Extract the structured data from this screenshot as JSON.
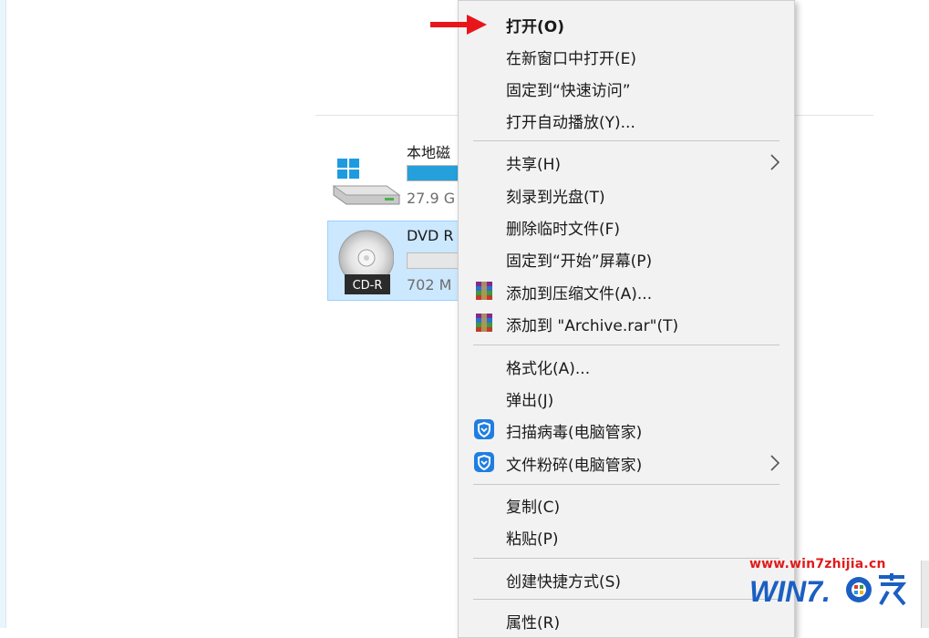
{
  "drives": [
    {
      "name": "本地磁",
      "size": "27.9 G",
      "usage_fraction": 0.85,
      "icon": "windows-drive-icon",
      "bar_color": "#26a0da"
    },
    {
      "name": "DVD R",
      "size": "702 M",
      "usage_fraction": 0.0,
      "icon": "cd-r-disc-icon",
      "badge": "CD-R",
      "selected": true
    }
  ],
  "context_menu": {
    "items": [
      {
        "label": "打开(O)",
        "bold": true
      },
      {
        "label": "在新窗口中打开(E)"
      },
      {
        "label": "固定到“快速访问”"
      },
      {
        "label": "打开自动播放(Y)..."
      },
      {
        "label": "共享(H)",
        "submenu": true
      },
      {
        "label": "刻录到光盘(T)"
      },
      {
        "label": "删除临时文件(F)"
      },
      {
        "label": "固定到“开始”屏幕(P)"
      },
      {
        "label": "添加到压缩文件(A)...",
        "icon": "winrar-icon"
      },
      {
        "label": "添加到 \"Archive.rar\"(T)",
        "icon": "winrar-icon"
      },
      {
        "label": "格式化(A)..."
      },
      {
        "label": "弹出(J)"
      },
      {
        "label": "扫描病毒(电脑管家)",
        "icon": "pc-manager-shield-icon"
      },
      {
        "label": "文件粉碎(电脑管家)",
        "icon": "pc-manager-shield-icon",
        "submenu": true
      },
      {
        "label": "复制(C)"
      },
      {
        "label": "粘贴(P)"
      },
      {
        "label": "创建快捷方式(S)"
      },
      {
        "label": "属性(R)"
      }
    ]
  },
  "pointer": {
    "icon": "red-arrow-icon",
    "color": "#e8161b"
  },
  "watermark": {
    "url": "www.win7zhijia.cn",
    "logo_text": "WIN7.之家",
    "logo_color": "#1b5fc2"
  }
}
